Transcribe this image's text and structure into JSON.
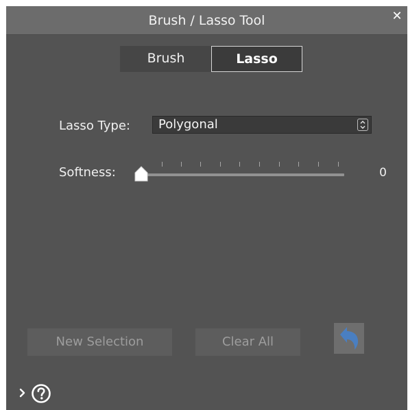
{
  "window": {
    "title": "Brush / Lasso Tool",
    "close_glyph": "✕",
    "close_icon": "close-icon"
  },
  "mode_tabs": {
    "brush_label": "Brush",
    "lasso_label": "Lasso",
    "selected": "Lasso"
  },
  "lasso_type": {
    "label": "Lasso Type:",
    "value": "Polygonal",
    "arrows_icon": "chevron-up-down-icon"
  },
  "softness": {
    "label": "Softness:",
    "value": "0",
    "min": 0,
    "max": 10,
    "level": 0
  },
  "actions": {
    "new_selection_label": "New Selection",
    "clear_all_label": "Clear All",
    "undo_icon": "undo-icon"
  },
  "footer": {
    "expand_icon": "chevron-right-icon",
    "help_icon": "help-icon"
  },
  "colors": {
    "panel_bg": "#535353",
    "titlebar_bg": "#6c6c6c",
    "undo_arrow": "#4a7fc1"
  }
}
